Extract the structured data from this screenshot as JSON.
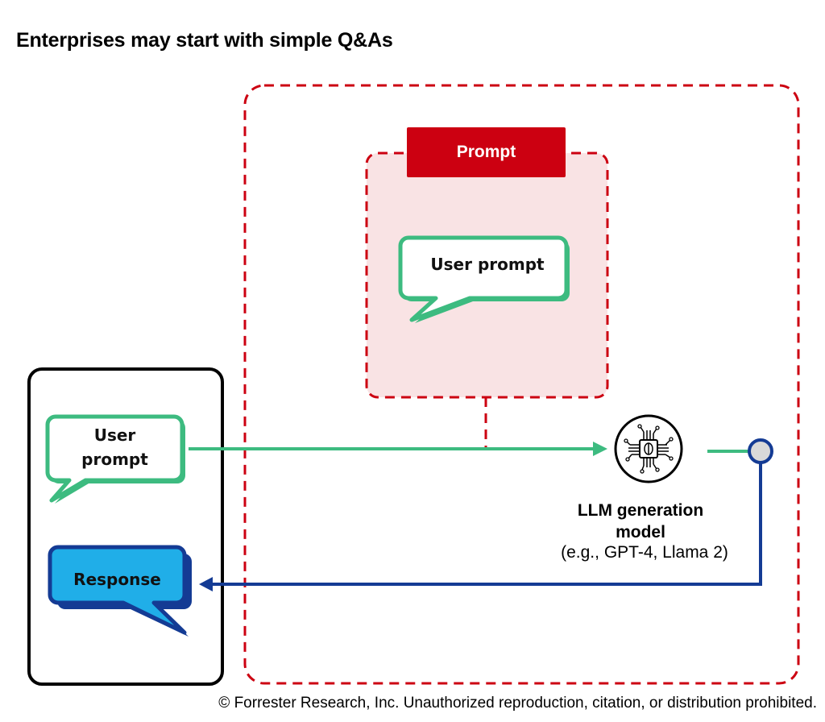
{
  "title": "Enterprises may start with simple Q&As",
  "prompt_box": {
    "header": "Prompt",
    "bubble_label": "User prompt"
  },
  "user_side": {
    "user_prompt_label_line1": "User",
    "user_prompt_label_line2": "prompt",
    "response_label": "Response"
  },
  "llm": {
    "icon": "ai-chip-brain-icon",
    "title_line1": "LLM generation",
    "title_line2": "model",
    "examples": "(e.g., GPT-4, Llama 2)"
  },
  "colors": {
    "red": "#cc0011",
    "pink_fill": "#f9e3e4",
    "green": "#3dbb80",
    "navy": "#143b94",
    "blue_fill": "#20aee8",
    "node_fill": "#d9d9d9"
  },
  "footer": "© Forrester Research, Inc. Unauthorized reproduction, citation, or distribution prohibited."
}
